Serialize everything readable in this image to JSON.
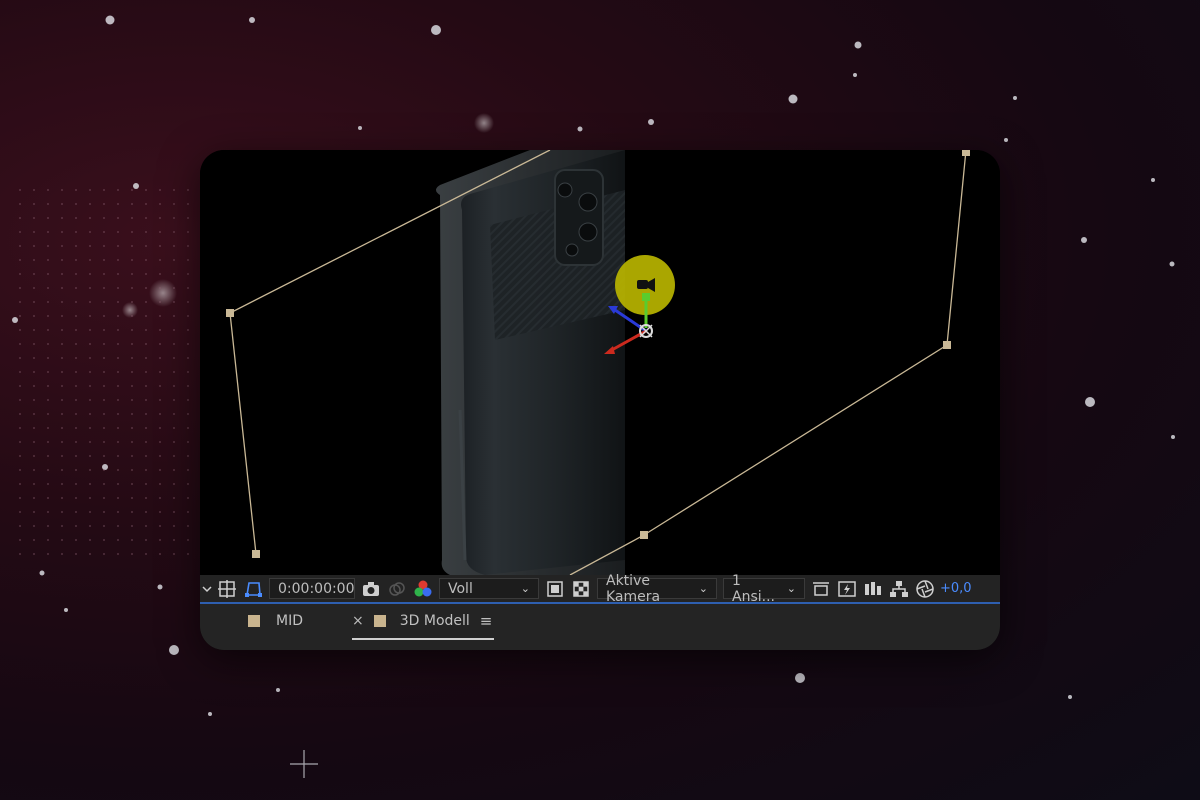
{
  "viewer": {
    "timecode": "0:00:00:00",
    "resolution": "Voll",
    "camera": "Aktive Kamera",
    "views": "1 Ansi...",
    "exposure": "+0,0"
  },
  "tabs": [
    {
      "label": "MID",
      "active": false
    },
    {
      "label": "3D Modell",
      "active": true
    }
  ],
  "icons": {
    "toolbar": [
      "chevron-down-icon",
      "grid-guides-icon",
      "mask-path-icon",
      "camera-snapshot-icon",
      "show-snapshot-icon",
      "channel-rgb-icon",
      "region-of-interest-icon",
      "transparency-grid-icon",
      "layout-icon",
      "fast-preview-icon",
      "flowchart-icon",
      "tree-icon",
      "exposure-reset-icon"
    ],
    "tabs": [
      "close-icon",
      "tab-menu-icon"
    ]
  },
  "colors": {
    "accent": "#2e5fb0",
    "exposure_text": "#4a8cff",
    "label_swatch": "#c9b48e",
    "camera_gizmo": "#c8c400"
  }
}
